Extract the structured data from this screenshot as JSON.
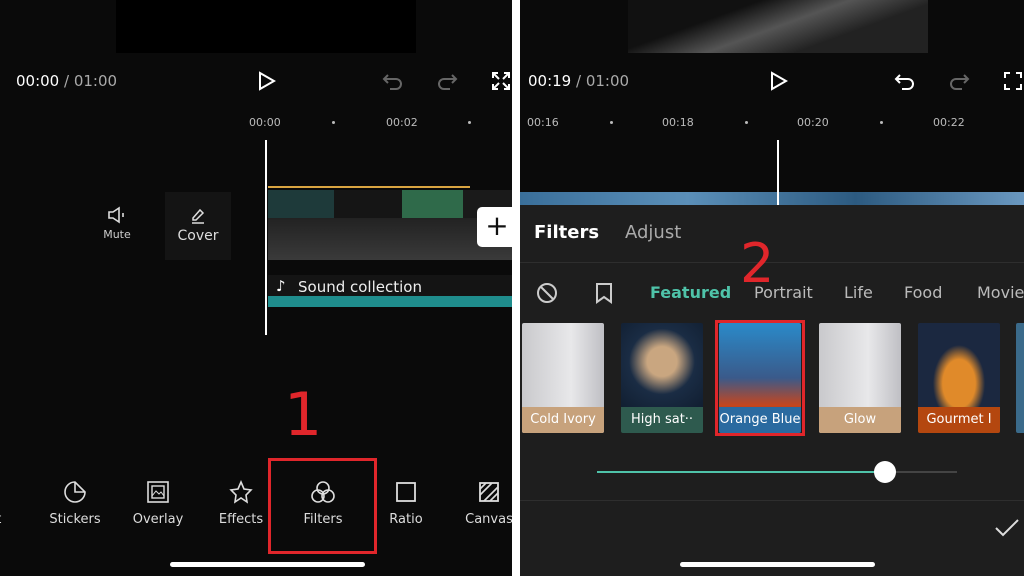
{
  "left": {
    "current_time": "00:00",
    "total_time": "/ 01:00",
    "ruler": [
      "00:00",
      "00:02"
    ],
    "mute_label": "Mute",
    "cover_label": "Cover",
    "audio_track": "Sound collection",
    "toolbar": [
      {
        "label": "xt",
        "icon": "text-icon"
      },
      {
        "label": "Stickers",
        "icon": "sticker-icon"
      },
      {
        "label": "Overlay",
        "icon": "overlay-icon"
      },
      {
        "label": "Effects",
        "icon": "effects-icon"
      },
      {
        "label": "Filters",
        "icon": "filters-icon"
      },
      {
        "label": "Ratio",
        "icon": "ratio-icon"
      },
      {
        "label": "Canvas",
        "icon": "canvas-icon"
      }
    ],
    "step": "1"
  },
  "right": {
    "current_time": "00:19",
    "total_time": "/ 01:00",
    "ruler": [
      "00:16",
      "00:18",
      "00:20",
      "00:22"
    ],
    "tabs": [
      "Filters",
      "Adjust"
    ],
    "categories": [
      "Featured",
      "Portrait",
      "Life",
      "Food",
      "Movie"
    ],
    "active_category": "Featured",
    "filters": [
      {
        "label": "Cold Ivory",
        "color": "#c7a27c"
      },
      {
        "label": "High sat··",
        "color": "#2e5a4e"
      },
      {
        "label": "Orange Blue",
        "color": "#2a6aa0"
      },
      {
        "label": "Glow",
        "color": "#c7a27c"
      },
      {
        "label": "Gourmet I",
        "color": "#b4470f"
      }
    ],
    "intensity_percent": 80,
    "step": "2"
  },
  "colors": {
    "accent": "#4fc3a9",
    "highlight": "#e0262b",
    "track_border": "#d9a441"
  }
}
